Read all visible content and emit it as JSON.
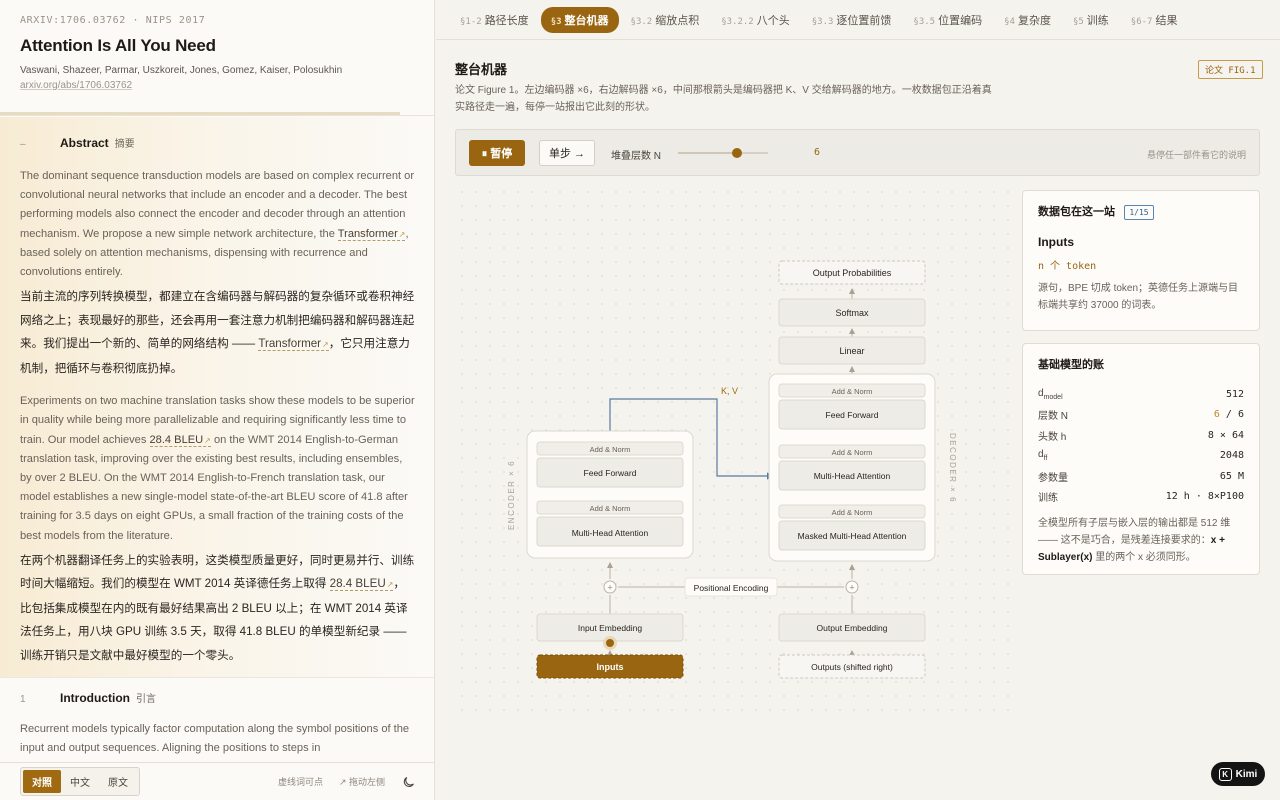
{
  "paper": {
    "meta": "ARXIV:1706.03762 · NIPS 2017",
    "title": "Attention Is All You Need",
    "authors": "Vaswani, Shazeer, Parmar, Uszkoreit, Jones, Gomez, Kaiser, Polosukhin",
    "link": "arxiv.org/abs/1706.03762"
  },
  "abstract": {
    "num": "–",
    "title": "Abstract",
    "zh_title": "摘要",
    "en1_a": "The dominant sequence transduction models are based on complex recurrent or convolutional neural networks that include an encoder and a decoder. The best performing models also connect the encoder and decoder through an attention mechanism. We propose a new simple network architecture, the ",
    "en1_term": "Transformer",
    "en1_b": ", based solely on attention mechanisms, dispensing with recurrence and convolutions entirely.",
    "zh1_a": "当前主流的序列转换模型，都建立在含编码器与解码器的复杂循环或卷积神经网络之上；表现最好的那些，还会再用一套注意力机制把编码器和解码器连起来。我们提出一个新的、简单的网络结构 —— ",
    "zh1_term": "Transformer",
    "zh1_b": "，它只用注意力机制，把循环与卷积彻底扔掉。",
    "en2_a": "Experiments on two machine translation tasks show these models to be superior in quality while being more parallelizable and requiring significantly less time to train. Our model achieves ",
    "en2_term": "28.4 BLEU",
    "en2_b": " on the WMT 2014 English-to-German translation task, improving over the existing best results, including ensembles, by over 2 BLEU. On the WMT 2014 English-to-French translation task, our model establishes a new single-model state-of-the-art BLEU score of 41.8 after training for 3.5 days on eight GPUs, a small fraction of the training costs of the best models from the literature.",
    "zh2_a": "在两个机器翻译任务上的实验表明，这类模型质量更好，同时更易并行、训练时间大幅缩短。我们的模型在 WMT 2014 英译德任务上取得 ",
    "zh2_term": "28.4 BLEU",
    "zh2_b": "，比包括集成模型在内的既有最好结果高出 2 BLEU 以上；在 WMT 2014 英译法任务上，用八块 GPU 训练 3.5 天，取得 41.8 BLEU 的单模型新纪录 —— 训练开销只是文献中最好模型的一个零头。"
  },
  "intro": {
    "num": "1",
    "title": "Introduction",
    "zh_title": "引言",
    "text": "Recurrent models typically factor computation along the symbol positions of the input and output sequences. Aligning the positions to steps in"
  },
  "footer": {
    "modes": [
      "对照",
      "中文",
      "原文"
    ],
    "active_mode": "对照",
    "hint1": "虚线词可点",
    "hint2": "↗ 拖动左侧"
  },
  "tabs": [
    {
      "num": "§1-2",
      "label": "路径长度",
      "active": false
    },
    {
      "num": "§3",
      "label": "整台机器",
      "active": true
    },
    {
      "num": "§3.2",
      "label": "缩放点积",
      "active": false
    },
    {
      "num": "§3.2.2",
      "label": "八个头",
      "active": false
    },
    {
      "num": "§3.3",
      "label": "逐位置前馈",
      "active": false
    },
    {
      "num": "§3.5",
      "label": "位置编码",
      "active": false
    },
    {
      "num": "§4",
      "label": "复杂度",
      "active": false
    },
    {
      "num": "§5",
      "label": "训练",
      "active": false
    },
    {
      "num": "§6-7",
      "label": "结果",
      "active": false
    }
  ],
  "machine": {
    "title": "整台机器",
    "badge": "论文 FIG.1",
    "desc": "论文 Figure 1。左边编码器 ×6，右边解码器 ×6，中间那根箭头是编码器把 K、V 交给解码器的地方。一枚数据包正沿着真实路径走一遍，每停一站报出它此刻的形状。"
  },
  "controls": {
    "pause_label": "⏸ 暂停",
    "step_label": "单步 →",
    "n_label": "堆叠层数 N",
    "n_value": "6",
    "n_fraction": 0.65,
    "hover_hint": "悬停任一部件看它的说明"
  },
  "diagram": {
    "output_probs": "Output Probabilities",
    "softmax": "Softmax",
    "linear": "Linear",
    "kv_label": "K, V",
    "decoder_side": "DECODER × 6",
    "encoder_side": "ENCODER × 6",
    "add_norm": "Add & Norm",
    "dec_ff": "Feed Forward",
    "dec_mha": "Multi-Head Attention",
    "dec_masked": "Masked Multi-Head Attention",
    "enc_ff": "Feed Forward",
    "enc_mha": "Multi-Head Attention",
    "pos_enc": "Positional Encoding",
    "input_emb": "Input Embedding",
    "output_emb": "Output Embedding",
    "inputs": "Inputs",
    "outputs": "Outputs (shifted right)"
  },
  "station": {
    "title": "数据包在这一站",
    "count": "1/15",
    "name": "Inputs",
    "shape": "n 个 token",
    "desc": "源句，BPE 切成 token；英德任务上源端与目标端共享约 37000 的词表。"
  },
  "ledger": {
    "title": "基础模型的账",
    "rows": [
      {
        "k": "d_model",
        "v": "512"
      },
      {
        "k": "层数 N",
        "v": "6 / 6"
      },
      {
        "k": "头数 h",
        "v": "8 × 64"
      },
      {
        "k": "d_ff",
        "v": "2048"
      },
      {
        "k": "参数量",
        "v": "65 M"
      },
      {
        "k": "训练",
        "v": "12 h · 8×P100"
      }
    ],
    "note_a": "全模型所有子层与嵌入层的输出都是 512 维 —— 这不是巧合，是残差连接要求的：",
    "note_b": "x + Sublayer(x)",
    "note_c": " 里的两个 x 必须同形。"
  },
  "kimi": {
    "label": "Kimi",
    "mark": "K"
  },
  "colors": {
    "accent": "#9a6511",
    "accent_light": "#c5842a",
    "link_blue": "#2b5f8a",
    "bg": "#f5f3ee"
  }
}
